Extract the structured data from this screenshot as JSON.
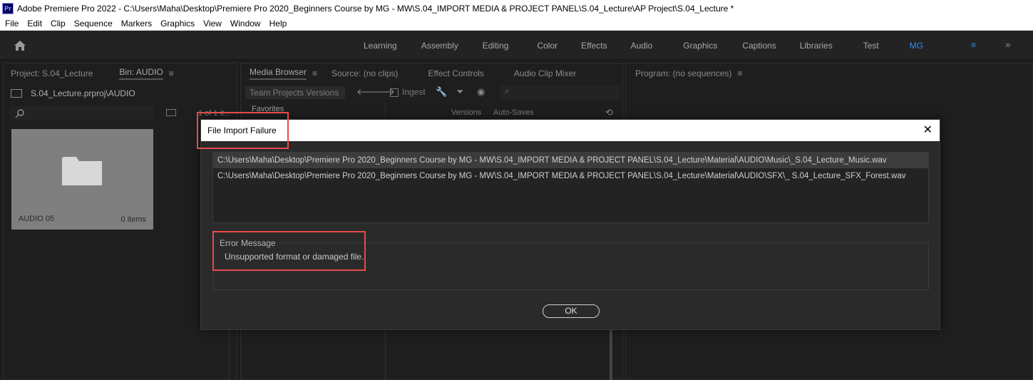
{
  "window": {
    "app_icon": "Pr",
    "title": "Adobe Premiere Pro 2022 - C:\\Users\\Maha\\Desktop\\Premiere Pro 2020_Beginners Course by MG - MW\\S.04_IMPORT MEDIA & PROJECT PANEL\\S.04_Lecture\\AP Project\\S.04_Lecture *"
  },
  "menu": [
    "File",
    "Edit",
    "Clip",
    "Sequence",
    "Markers",
    "Graphics",
    "View",
    "Window",
    "Help"
  ],
  "workspaces": {
    "tabs": [
      "Learning",
      "Assembly",
      "Editing",
      "Color",
      "Effects",
      "Audio",
      "Graphics",
      "Captions",
      "Libraries",
      "Test",
      "MG"
    ],
    "active": "MG",
    "menu_icon": "≡",
    "overflow_icon": "»"
  },
  "project_panel": {
    "tab_project": "Project: S.04_Lecture",
    "tab_bin": "Bin: AUDIO",
    "path": "S.04_Lecture.prproj\\AUDIO",
    "item_count": "1 of 1 it...",
    "folder": {
      "name": "AUDIO 05",
      "count": "0 items"
    }
  },
  "media_panel": {
    "tabs": [
      "Media Browser",
      "Source: (no clips)",
      "Effect Controls",
      "Audio Clip Mixer"
    ],
    "team_projects": "Team Projects Versions",
    "ingest": "Ingest",
    "favorites": "Favorites",
    "versions": "Versions",
    "autosaves": "Auto-Saves"
  },
  "program_panel": {
    "tab": "Program: (no sequences)"
  },
  "dialog": {
    "title": "File Import Failure",
    "close_glyph": "✕",
    "files": [
      "C:\\Users\\Maha\\Desktop\\Premiere Pro 2020_Beginners Course by MG - MW\\S.04_IMPORT MEDIA & PROJECT PANEL\\S.04_Lecture\\Material\\AUDIO\\Music\\_S.04_Lecture_Music.wav",
      "C:\\Users\\Maha\\Desktop\\Premiere Pro 2020_Beginners Course by MG - MW\\S.04_IMPORT MEDIA & PROJECT PANEL\\S.04_Lecture\\Material\\AUDIO\\SFX\\_ S.04_Lecture_SFX_Forest.wav"
    ],
    "error_label": "Error Message",
    "error_text": "Unsupported format or damaged file.",
    "ok": "OK"
  },
  "colors": {
    "highlight": "#e84a4a",
    "active_workspace": "#2d8ceb"
  }
}
